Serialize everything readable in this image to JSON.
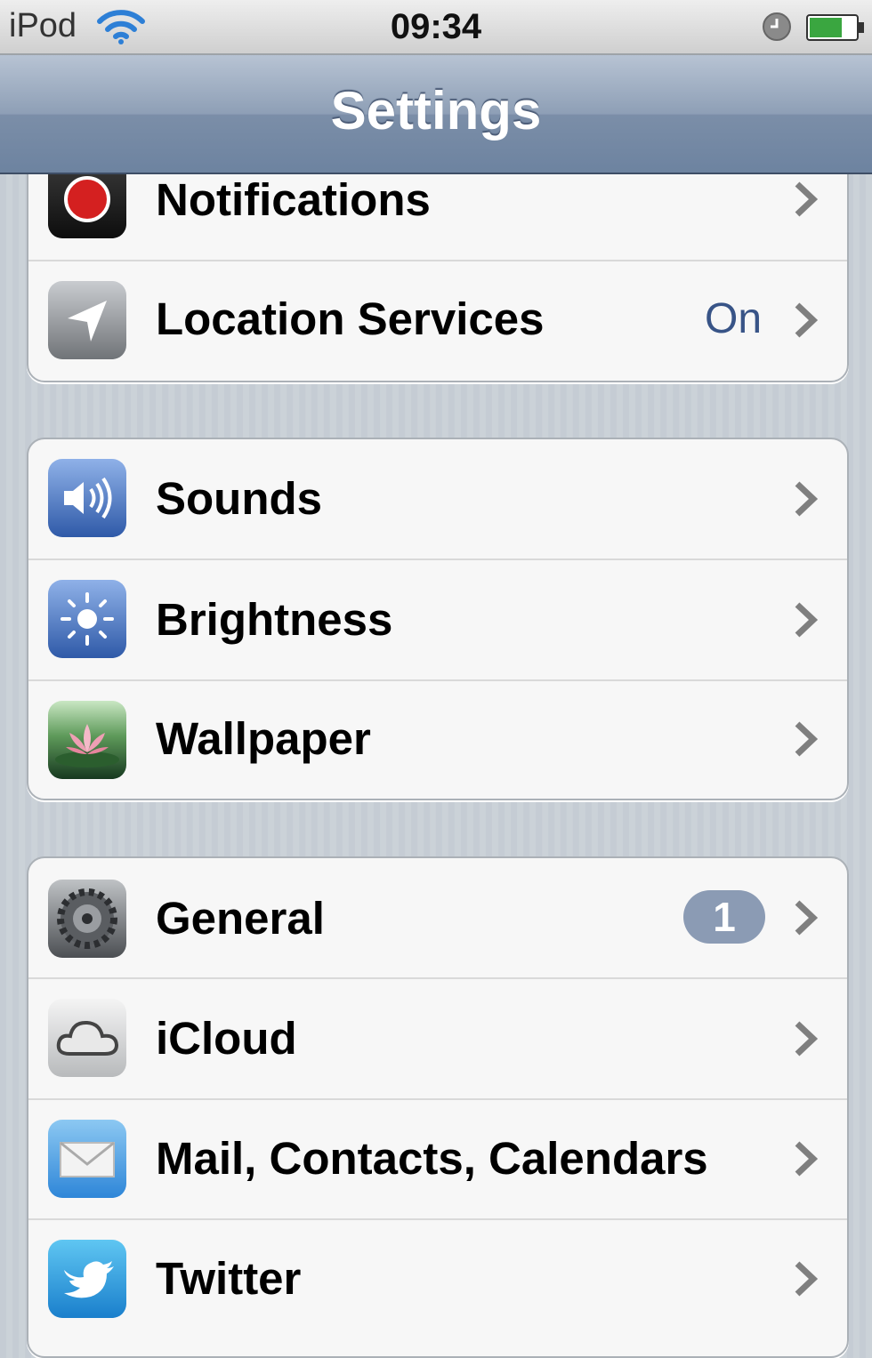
{
  "status_bar": {
    "carrier": "iPod",
    "time": "09:34",
    "wifi_icon": "wifi-icon",
    "clock_icon": "clock-icon",
    "battery_icon": "battery-icon",
    "battery_level": 0.7
  },
  "nav": {
    "title": "Settings"
  },
  "groups": [
    {
      "items": [
        {
          "label": "Notifications",
          "icon": "notifications-icon"
        },
        {
          "label": "Location Services",
          "value": "On",
          "icon": "location-arrow-icon"
        }
      ]
    },
    {
      "items": [
        {
          "label": "Sounds",
          "icon": "speaker-icon"
        },
        {
          "label": "Brightness",
          "icon": "sun-icon"
        },
        {
          "label": "Wallpaper",
          "icon": "lotus-flower-icon"
        }
      ]
    },
    {
      "items": [
        {
          "label": "General",
          "badge": "1",
          "icon": "gears-icon"
        },
        {
          "label": "iCloud",
          "icon": "cloud-icon"
        },
        {
          "label": "Mail, Contacts, Calendars",
          "icon": "envelope-icon"
        },
        {
          "label": "Twitter",
          "icon": "twitter-bird-icon"
        }
      ]
    }
  ],
  "colors": {
    "nav_bar": "#7b8ea8",
    "value_text": "#385487",
    "badge": "#8b9bb4",
    "background": "#c5ccd4"
  }
}
